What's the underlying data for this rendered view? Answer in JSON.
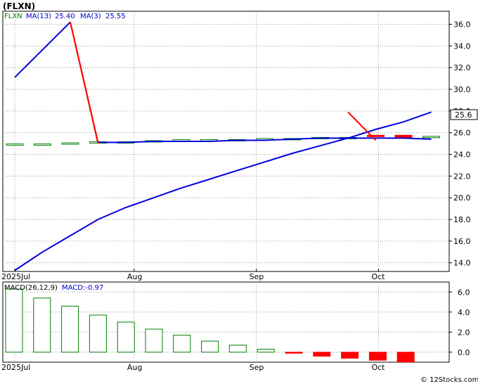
{
  "title": "(FLXN)",
  "watermark": "© 12Stocks.com",
  "price_legend": {
    "symbol": "FLXN",
    "ma13_label": "MA(13)",
    "ma13_value": "25.40",
    "ma3_label": "MA(3)",
    "ma3_value": "25.55"
  },
  "macd_legend": {
    "label": "MACD(26,12,9)",
    "value_label": "MACD:-0.97"
  },
  "last_price_tag": "25.6",
  "colors": {
    "ma_line": "#0000dd",
    "price_down": "#ff0000",
    "up_bar": "#008000",
    "down_bar": "#ff0000",
    "symbol_text": "#008000",
    "legend_text": "#0000cc",
    "grid": "#999999"
  },
  "chart_data": [
    {
      "type": "line",
      "name": "price panel",
      "x": [
        "Jul 1",
        "Jul 8",
        "Jul 15",
        "Jul 22",
        "Jul 29",
        "Aug 5",
        "Aug 12",
        "Aug 19",
        "Aug 26",
        "Sep 2",
        "Sep 9",
        "Sep 16",
        "Sep 23",
        "Sep 30",
        "Oct 7",
        "Oct 14"
      ],
      "x_tick_labels": [
        "2025Jul",
        "Aug",
        "Sep",
        "Oct"
      ],
      "y_ticks": [
        14.0,
        16.0,
        18.0,
        20.0,
        22.0,
        24.0,
        26.0,
        28.0,
        30.0,
        32.0,
        34.0,
        36.0
      ],
      "ylim": [
        13.2,
        37.2
      ],
      "grid": true,
      "series": [
        {
          "name": "MA(13)",
          "values": [
            13.3,
            15.0,
            16.5,
            18.0,
            19.1,
            20.0,
            20.9,
            21.7,
            22.5,
            23.3,
            24.1,
            24.8,
            25.5,
            26.3,
            27.0,
            27.9
          ]
        },
        {
          "name": "MA(3)",
          "values": [
            31.1,
            null,
            36.2,
            25.1,
            25.1,
            25.2,
            25.2,
            25.2,
            25.3,
            25.3,
            25.4,
            25.5,
            25.5,
            25.5,
            25.5,
            25.4
          ]
        },
        {
          "name": "close",
          "values": [
            null,
            null,
            36.2,
            25.0,
            null,
            null,
            null,
            null,
            null,
            null,
            null,
            null,
            27.9,
            25.3,
            null,
            null
          ]
        }
      ],
      "weekly_bars": {
        "open": [
          24.9,
          24.9,
          25.0,
          25.0,
          25.1,
          25.2,
          25.2,
          25.3,
          25.3,
          25.3,
          25.4,
          25.5,
          25.5,
          25.7,
          25.5,
          25.5
        ],
        "close": [
          24.9,
          24.9,
          25.0,
          25.1,
          25.1,
          25.2,
          25.3,
          25.3,
          25.3,
          25.4,
          25.4,
          25.5,
          25.5,
          25.6,
          25.7,
          25.6
        ],
        "direction": [
          "up",
          "up",
          "up",
          "up",
          "up",
          "up",
          "up",
          "up",
          "up",
          "up",
          "up",
          "up",
          "up",
          "down",
          "down",
          "up"
        ]
      }
    },
    {
      "type": "bar",
      "name": "macd panel",
      "x_tick_labels": [
        "2025Jul",
        "Aug",
        "Sep",
        "Oct"
      ],
      "y_ticks": [
        0.0,
        2.0,
        4.0,
        6.0
      ],
      "ylim": [
        -1.0,
        7.0
      ],
      "values": [
        6.3,
        5.4,
        4.6,
        3.7,
        3.0,
        2.3,
        1.7,
        1.1,
        0.7,
        0.3,
        -0.1,
        -0.4,
        -0.6,
        -0.8,
        -0.97
      ],
      "direction": [
        "up",
        "up",
        "up",
        "up",
        "up",
        "up",
        "up",
        "up",
        "up",
        "up",
        "down",
        "down",
        "down",
        "down",
        "down"
      ]
    }
  ]
}
